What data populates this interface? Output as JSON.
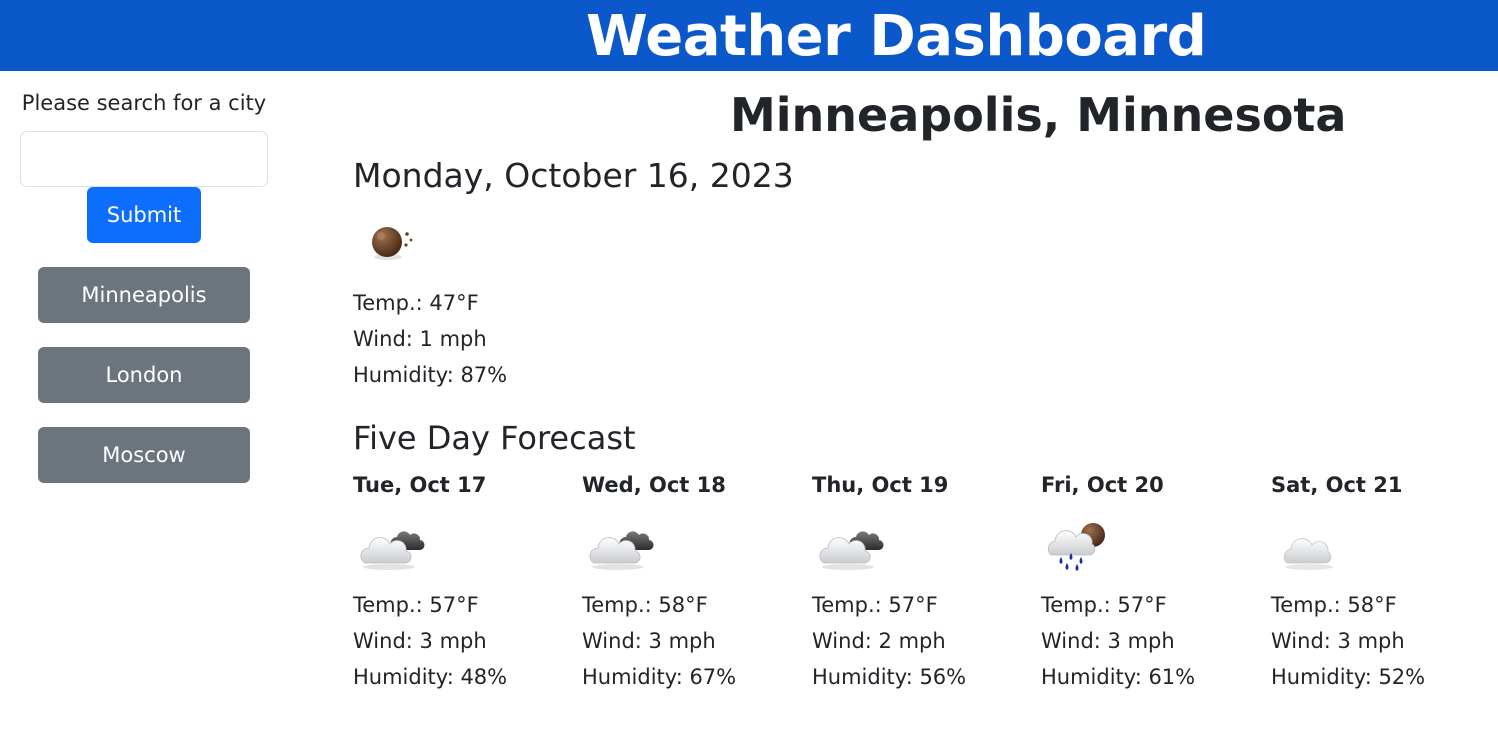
{
  "header": {
    "title": "Weather Dashboard"
  },
  "sidebar": {
    "search_label": "Please search for a city",
    "search_value": "",
    "submit_label": "Submit",
    "history": [
      "Minneapolis",
      "London",
      "Moscow"
    ]
  },
  "current": {
    "city": "Minneapolis, Minnesota",
    "date": "Monday, October 16, 2023",
    "icon": "moon-icon",
    "temp": "Temp.: 47°F",
    "wind": "Wind: 1 mph",
    "humidity": "Humidity: 87%"
  },
  "forecast": {
    "title": "Five Day Forecast",
    "days": [
      {
        "date": "Tue, Oct 17",
        "icon": "partly-cloudy-icon",
        "temp": "Temp.: 57°F",
        "wind": "Wind: 3 mph",
        "humidity": "Humidity: 48%"
      },
      {
        "date": "Wed, Oct 18",
        "icon": "partly-cloudy-icon",
        "temp": "Temp.: 58°F",
        "wind": "Wind: 3 mph",
        "humidity": "Humidity: 67%"
      },
      {
        "date": "Thu, Oct 19",
        "icon": "partly-cloudy-icon",
        "temp": "Temp.: 57°F",
        "wind": "Wind: 2 mph",
        "humidity": "Humidity: 56%"
      },
      {
        "date": "Fri, Oct 20",
        "icon": "rain-night-icon",
        "temp": "Temp.: 57°F",
        "wind": "Wind: 3 mph",
        "humidity": "Humidity: 61%"
      },
      {
        "date": "Sat, Oct 21",
        "icon": "cloud-icon",
        "temp": "Temp.: 58°F",
        "wind": "Wind: 3 mph",
        "humidity": "Humidity: 52%"
      }
    ]
  },
  "colors": {
    "header_bg": "#0a58ca",
    "primary_button": "#0d6efd",
    "secondary_button": "#6c757d",
    "text": "#212529"
  }
}
